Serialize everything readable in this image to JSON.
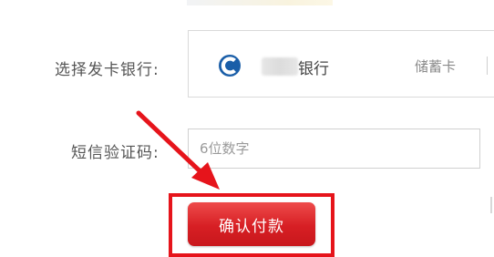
{
  "form": {
    "bank_label": "选择发卡银行:",
    "sms_label": "短信验证码:"
  },
  "bank": {
    "name": "银行",
    "card_type": "储蓄卡",
    "logo_icon": "china-construction-bank-logo",
    "logo_color": "#1a5ea8"
  },
  "sms_input": {
    "value": "",
    "placeholder": "6位数字"
  },
  "confirm_button": {
    "label": "确认付款",
    "color": "#d71f24"
  },
  "annotation": {
    "arrow_icon": "red-arrow-pointer",
    "highlight_color": "#e6141b"
  }
}
